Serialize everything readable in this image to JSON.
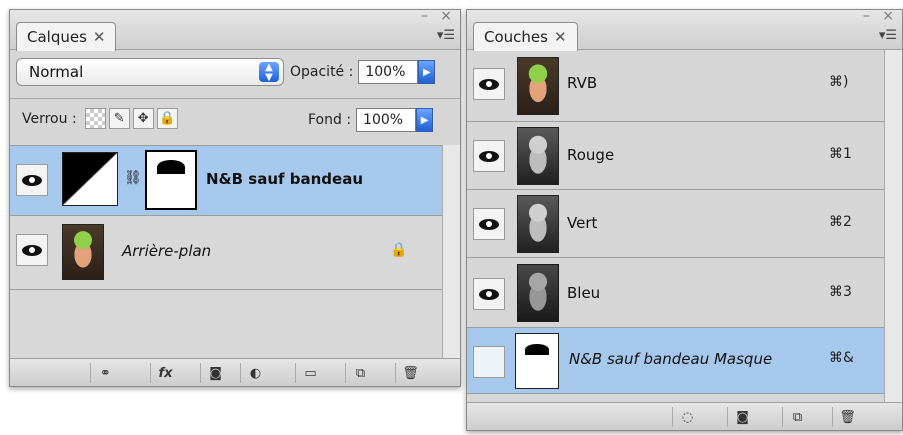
{
  "calques": {
    "tab_label": "Calques",
    "blend_mode": "Normal",
    "opacity_label": "Opacité :",
    "opacity_value": "100%",
    "lock_label": "Verrou :",
    "fill_label": "Fond :",
    "fill_value": "100%",
    "layers": [
      {
        "name": "N&B sauf bandeau"
      },
      {
        "name": "Arrière-plan"
      }
    ]
  },
  "couches": {
    "tab_label": "Couches",
    "channels": [
      {
        "name": "RVB",
        "shortcut": "⌘)"
      },
      {
        "name": "Rouge",
        "shortcut": "⌘1"
      },
      {
        "name": "Vert",
        "shortcut": "⌘2"
      },
      {
        "name": "Bleu",
        "shortcut": "⌘3"
      },
      {
        "name": "N&B sauf bandeau Masque",
        "shortcut": "⌘&"
      }
    ]
  },
  "icons": {
    "close": "✕",
    "menu": "▾☰",
    "link": "🔗",
    "lock": "🔒"
  },
  "colors": {
    "selection": "#a6c8ed",
    "accent": "#1f5fd6"
  }
}
